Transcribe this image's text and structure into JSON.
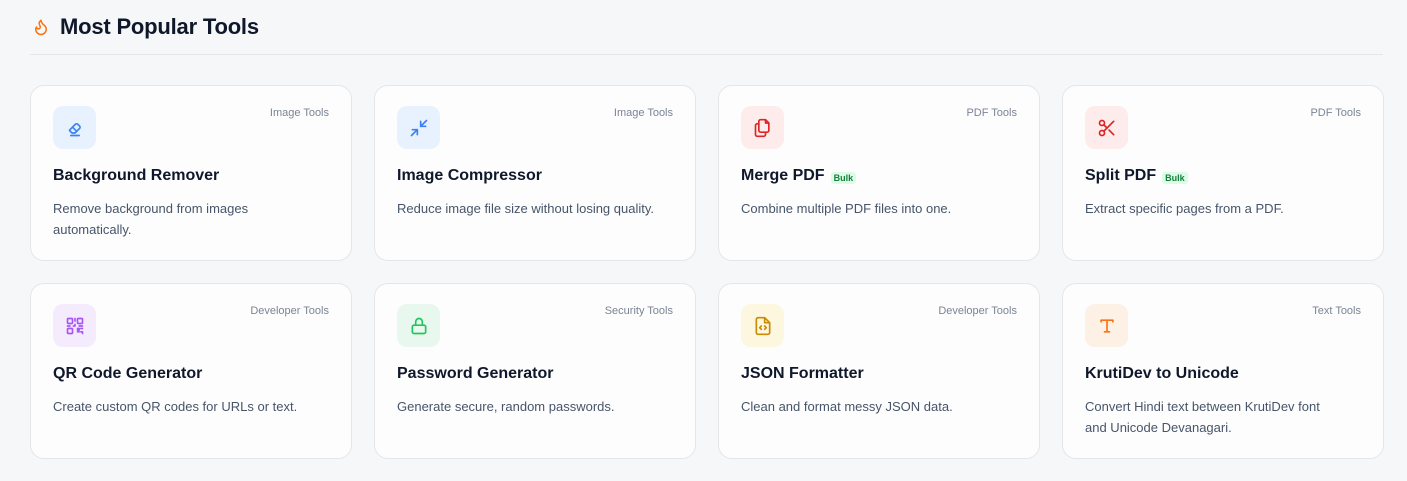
{
  "section": {
    "title": "Most Popular Tools",
    "icon": "flame-icon",
    "accent": "#f97316"
  },
  "tools": [
    {
      "id": "background-remover",
      "title": "Background Remover",
      "category": "Image Tools",
      "description": "Remove background from images automatically.",
      "badge": "",
      "icon": "eraser-icon",
      "color": "#3b82f6",
      "bg": "#e8f1fe"
    },
    {
      "id": "image-compressor",
      "title": "Image Compressor",
      "category": "Image Tools",
      "description": "Reduce image file size without losing quality.",
      "badge": "",
      "icon": "compress-arrows-icon",
      "color": "#3b82f6",
      "bg": "#e8f1fe"
    },
    {
      "id": "merge-pdf",
      "title": "Merge PDF",
      "category": "PDF Tools",
      "description": "Combine multiple PDF files into one.",
      "badge": "Bulk",
      "icon": "files-icon",
      "color": "#dc2626",
      "bg": "#fdeceb"
    },
    {
      "id": "split-pdf",
      "title": "Split PDF",
      "category": "PDF Tools",
      "description": "Extract specific pages from a PDF.",
      "badge": "Bulk",
      "icon": "scissors-icon",
      "color": "#dc2626",
      "bg": "#fdeceb"
    },
    {
      "id": "qr-code-generator",
      "title": "QR Code Generator",
      "category": "Developer Tools",
      "description": "Create custom QR codes for URLs or text.",
      "badge": "",
      "icon": "qr-code-icon",
      "color": "#a855f7",
      "bg": "#f4ecfd"
    },
    {
      "id": "password-generator",
      "title": "Password Generator",
      "category": "Security Tools",
      "description": "Generate secure, random passwords.",
      "badge": "",
      "icon": "lock-icon",
      "color": "#22c55e",
      "bg": "#e9f8ee"
    },
    {
      "id": "json-formatter",
      "title": "JSON Formatter",
      "category": "Developer Tools",
      "description": "Clean and format messy JSON data.",
      "badge": "",
      "icon": "code-file-icon",
      "color": "#ca8a04",
      "bg": "#fdf7df"
    },
    {
      "id": "krutidev-to-unicode",
      "title": "KrutiDev to Unicode",
      "category": "Text Tools",
      "description": "Convert Hindi text between KrutiDev font and Unicode Devanagari.",
      "badge": "",
      "icon": "type-icon",
      "color": "#f97316",
      "bg": "#fdf0e4"
    }
  ]
}
